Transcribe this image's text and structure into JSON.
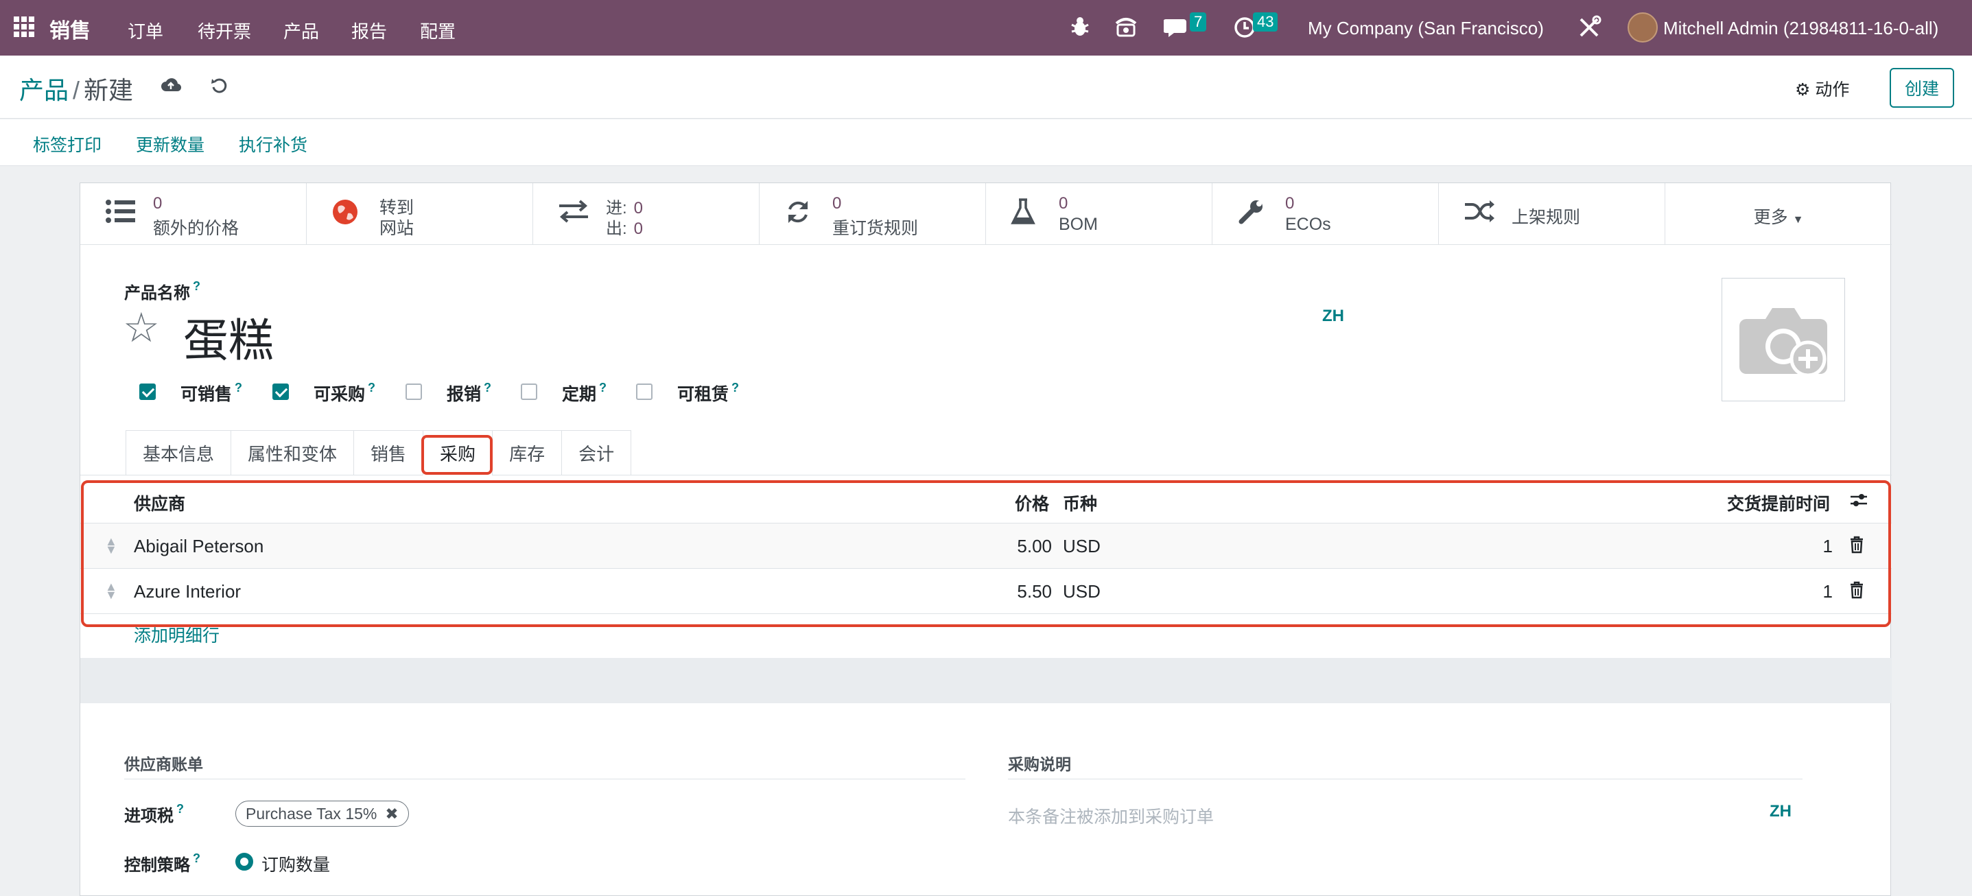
{
  "topbar": {
    "app_name": "销售",
    "menu": [
      "订单",
      "待开票",
      "产品",
      "报告",
      "配置"
    ],
    "messages_count": "7",
    "activities_count": "43",
    "company": "My Company (San Francisco)",
    "user": "Mitchell Admin (21984811-16-0-all)"
  },
  "breadcrumb": {
    "parent": "产品",
    "separator": "/",
    "current": "新建"
  },
  "control": {
    "actions_label": "动作",
    "create_label": "创建"
  },
  "header_buttons": [
    "标签打印",
    "更新数量",
    "执行补货"
  ],
  "smart_buttons": {
    "extra_prices": {
      "value": "0",
      "label": "额外的价格"
    },
    "website": {
      "line1": "转到",
      "line2": "网站"
    },
    "in_out": {
      "in_label": "进:",
      "in_value": "0",
      "out_label": "出:",
      "out_value": "0"
    },
    "reorder": {
      "value": "0",
      "label": "重订货规则"
    },
    "bom": {
      "value": "0",
      "label": "BOM"
    },
    "ecos": {
      "value": "0",
      "label": "ECOs"
    },
    "putaway": {
      "label": "上架规则"
    },
    "more": {
      "label": "更多"
    }
  },
  "form": {
    "name_label": "产品名称",
    "help_mark": "?",
    "name_value": "蛋糕",
    "lang_code": "ZH",
    "checkboxes": [
      {
        "label": "可销售",
        "checked": true
      },
      {
        "label": "可采购",
        "checked": true
      },
      {
        "label": "报销",
        "checked": false
      },
      {
        "label": "定期",
        "checked": false
      },
      {
        "label": "可租赁",
        "checked": false
      }
    ],
    "tabs": [
      "基本信息",
      "属性和变体",
      "销售",
      "采购",
      "库存",
      "会计"
    ],
    "active_tab": "采购"
  },
  "vendor_table": {
    "columns": {
      "vendor": "供应商",
      "price": "价格",
      "currency": "币种",
      "lead_time": "交货提前时间"
    },
    "rows": [
      {
        "vendor": "Abigail Peterson",
        "price": "5.00",
        "currency": "USD",
        "lead_time": "1"
      },
      {
        "vendor": "Azure Interior",
        "price": "5.50",
        "currency": "USD",
        "lead_time": "1"
      }
    ],
    "add_line": "添加明细行"
  },
  "vendor_bills": {
    "section_title": "供应商账单",
    "tax_label": "进项税",
    "tax_tag": "Purchase Tax 15%",
    "policy_label": "控制策略",
    "policy_value": "订购数量"
  },
  "purchase_desc": {
    "section_title": "采购说明",
    "placeholder": "本条备注被添加到采购订单",
    "lang_code": "ZH"
  },
  "colors": {
    "brand": "#714b67",
    "accent": "#017e84",
    "highlight": "#e0412b"
  }
}
